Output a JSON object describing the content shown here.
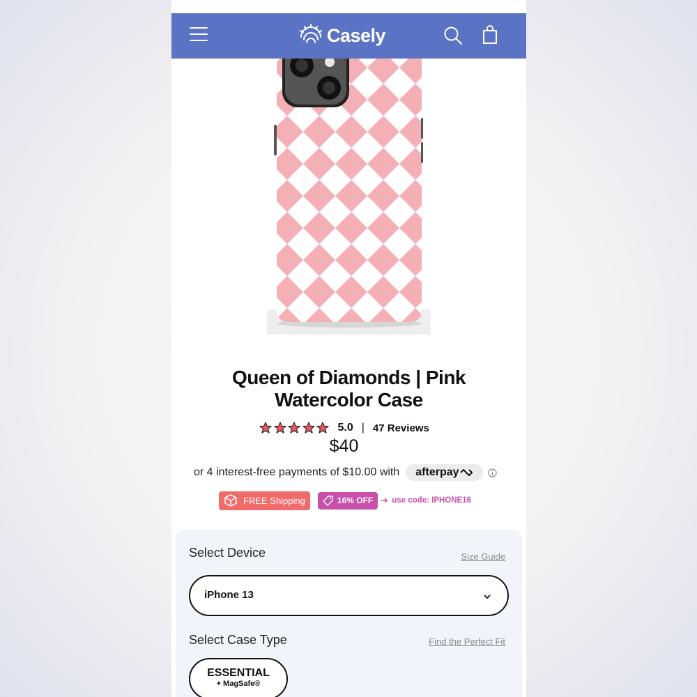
{
  "header": {
    "brand": "Casely",
    "menu_icon": "hamburger-menu-icon",
    "search_icon": "search-icon",
    "cart_icon": "shopping-bag-icon",
    "bar_color": "#5b73c4"
  },
  "product": {
    "title": "Queen of Diamonds | Pink Watercolor Case",
    "rating": "5.0",
    "stars": 5,
    "rating_separator": "|",
    "reviews": "47 Reviews",
    "price": "$40",
    "installments_text": "or 4 interest-free payments of $10.00 with",
    "afterpay_label": "afterpay",
    "pattern_color": "#f2a2a8"
  },
  "promos": {
    "free_shipping": "FREE Shipping",
    "discount": "16% OFF",
    "code_text": "use code: IPHONE16",
    "shipping_color": "#f26b6b",
    "discount_color": "#c94faa"
  },
  "options": {
    "device_label": "Select Device",
    "size_guide": "Size Guide",
    "device_value": "iPhone 13",
    "case_type_label": "Select Case Type",
    "perfect_fit": "Find the Perfect Fit",
    "case_type_main": "ESSENTIAL",
    "case_type_sub": "+ MagSafe®"
  }
}
